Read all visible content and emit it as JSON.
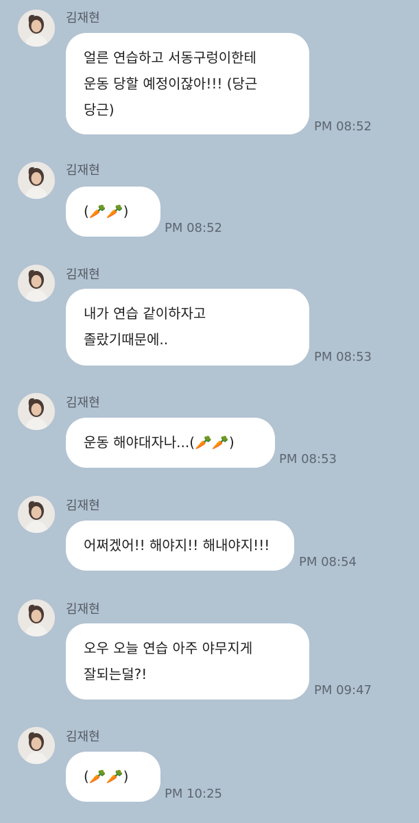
{
  "conversation": {
    "messages": [
      {
        "sender": "김재현",
        "text": "얼른 연습하고 서동구렁이한테\n운동 당할 예정이잖아!!! (당근\n당근)",
        "time": "PM 08:52"
      },
      {
        "sender": "김재현",
        "text": "(🥕🥕)",
        "time": "PM 08:52"
      },
      {
        "sender": "김재현",
        "text": "내가 연습 같이하자고\n졸랐기때문에..",
        "time": "PM 08:53"
      },
      {
        "sender": "김재현",
        "text": "운동 해야대자나...(🥕🥕)",
        "time": "PM 08:53"
      },
      {
        "sender": "김재현",
        "text": "어쩌겠어!! 해야지!! 해내야지!!!",
        "time": "PM 08:54"
      },
      {
        "sender": "김재현",
        "text": "오우 오늘 연습 아주 야무지게\n잘되는덜?!",
        "time": "PM 09:47"
      },
      {
        "sender": "김재현",
        "text": "(🥕🥕)",
        "time": "PM 10:25"
      }
    ]
  },
  "colors": {
    "background": "#b2c3d2",
    "bubble": "#ffffff",
    "text": "#1e1e1e",
    "meta_text": "#5d6670"
  },
  "icons": {
    "avatar": "profile-photo-icon"
  }
}
